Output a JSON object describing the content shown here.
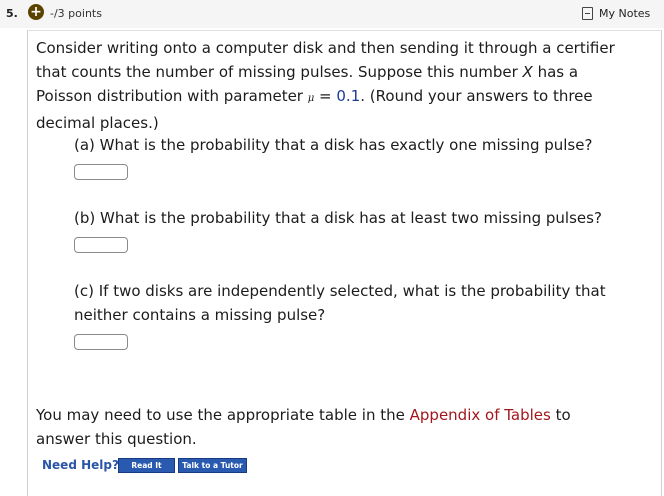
{
  "header": {
    "question_number": "5.",
    "points": "-/3 points",
    "my_notes_label": "My Notes",
    "accent_color": "#5a4200"
  },
  "question": {
    "intro_lines": [
      "Consider writing onto a computer disk and then sending it through a certifier",
      "that counts the number of missing pulses. Suppose this number"
    ],
    "var_x": "X",
    "intro_line2_end": "has a",
    "line3_start": "Poisson distribution with parameter",
    "param_symbol": "μ",
    "equals": "=",
    "param_value": "0.1",
    "line3_end": ". (Round your answers to three",
    "line4": "decimal places.)",
    "parts": [
      {
        "lines": [
          "(a) What is the probability that a disk has exactly one missing pulse?"
        ],
        "answer": ""
      },
      {
        "lines": [
          "(b) What is the probability that a disk has at least two missing pulses?"
        ],
        "answer": ""
      },
      {
        "lines": [
          "(c) If two disks are independently selected, what is the probability that",
          "neither contains a missing pulse?"
        ],
        "answer": ""
      }
    ]
  },
  "footer": {
    "line1_start": "You may need to use the appropriate table in the",
    "appendix_link": "Appendix of Tables",
    "line1_end": "to",
    "line2": "answer this question."
  },
  "help": {
    "need_help": "Need Help?",
    "read_it": "Read It",
    "talk_to_tutor": "Talk to a Tutor"
  },
  "colors": {
    "link_red": "#a2171c",
    "param_blue": "#1a3c94",
    "help_blue": "#2a55a6",
    "button_blue": "#2a5ab0"
  }
}
